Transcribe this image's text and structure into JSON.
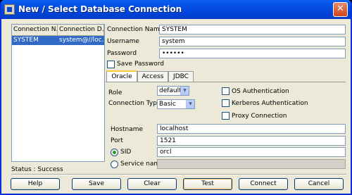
{
  "window": {
    "title": "New / Select Database Connection"
  },
  "connections": {
    "columns": [
      "Connection N...",
      "Connection D..."
    ],
    "rows": [
      {
        "name": "SYSTEM",
        "details": "system@//loc..."
      }
    ]
  },
  "form": {
    "connection_name_label": "Connection Name",
    "connection_name_value": "SYSTEM",
    "username_label": "Username",
    "username_value": "system",
    "password_label": "Password",
    "password_value": "••••••",
    "save_password_label": "Save Password"
  },
  "tabs": [
    "Oracle",
    "Access",
    "JDBC"
  ],
  "oracle": {
    "role_label": "Role",
    "role_value": "default",
    "connection_type_label": "Connection Type",
    "connection_type_value": "Basic",
    "os_auth_label": "OS Authentication",
    "kerberos_label": "Kerberos Authentication",
    "proxy_label": "Proxy Connection",
    "hostname_label": "Hostname",
    "hostname_value": "localhost",
    "port_label": "Port",
    "port_value": "1521",
    "sid_label": "SID",
    "sid_value": "orcl",
    "service_name_label": "Service name",
    "service_name_value": ""
  },
  "status": "Status : Success",
  "buttons": {
    "help": "Help",
    "save": "Save",
    "clear": "Clear",
    "test": "Test",
    "connect": "Connect",
    "cancel": "Cancel"
  }
}
